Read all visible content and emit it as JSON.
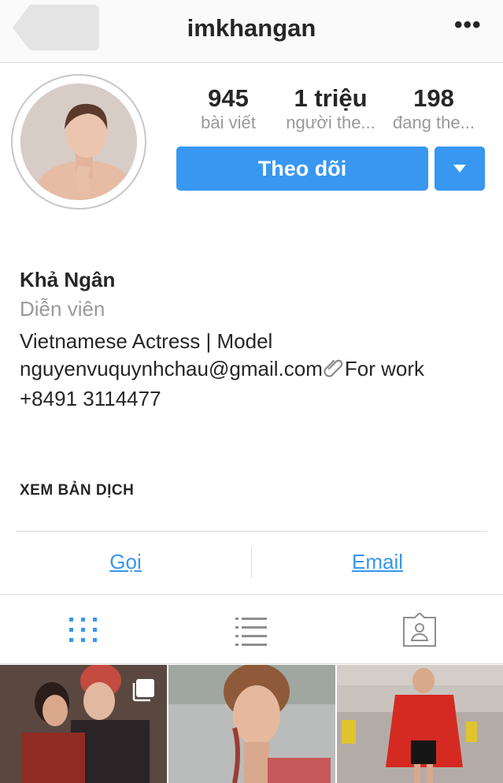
{
  "header": {
    "username": "imkhangan",
    "back_icon": "back-arrow-icon",
    "more_icon": "more-options-icon",
    "more_glyph": "•••"
  },
  "stats": [
    {
      "value": "945",
      "label": "bài viết"
    },
    {
      "value": "1 triệu",
      "label": "người the..."
    },
    {
      "value": "198",
      "label": "đang the..."
    }
  ],
  "actions": {
    "follow_label": "Theo dõi",
    "dropdown_icon": "chevron-down-icon"
  },
  "bio": {
    "name": "Khả Ngân",
    "category": "Diễn viên",
    "line1": "Vietnamese Actress | Model",
    "email": "nguyenvuquynhchau@gmail.com",
    "work_note": "For work",
    "phone": "+8491 3114477",
    "translate": "XEM BẢN DỊCH"
  },
  "contact": {
    "call": "Gọi",
    "email": "Email"
  },
  "tabs": [
    {
      "icon": "grid-view-icon",
      "active": true
    },
    {
      "icon": "list-view-icon",
      "active": false
    },
    {
      "icon": "tagged-photos-icon",
      "active": false
    }
  ],
  "colors": {
    "accent": "#3897f0",
    "text": "#262626",
    "muted": "#999999",
    "divider": "#dbdbdb"
  }
}
